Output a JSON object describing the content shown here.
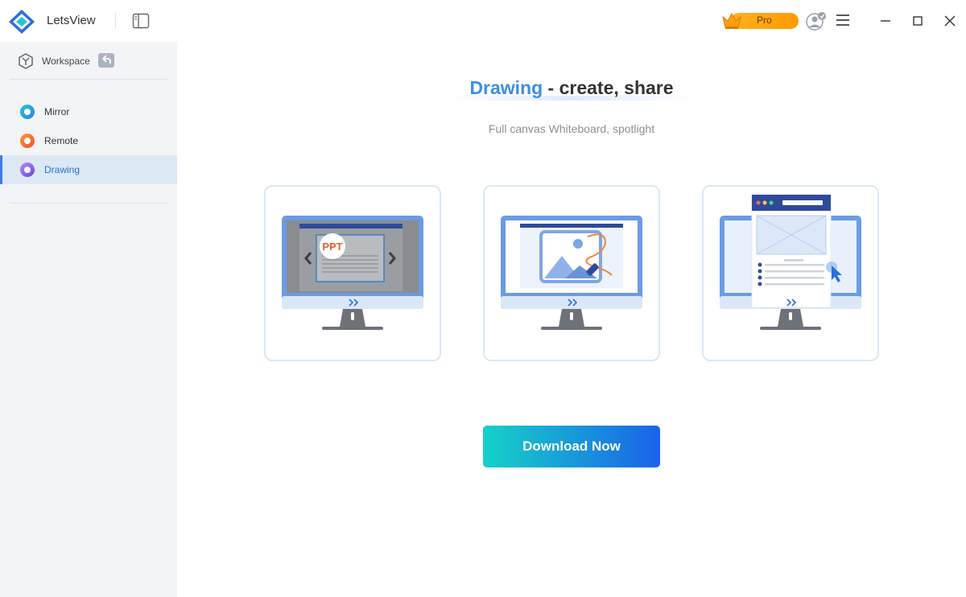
{
  "app": {
    "title": "LetsView"
  },
  "titlebar": {
    "pro_label": "Pro",
    "icons": [
      "letsview-logo-icon",
      "sidebar-toggle-icon",
      "crown-icon",
      "user-icon",
      "menu-icon",
      "minimize-icon",
      "maximize-icon",
      "close-icon"
    ]
  },
  "sidebar": {
    "workspace_label": "Workspace",
    "items": [
      {
        "label": "Mirror",
        "icon": "mirror-icon",
        "active": false
      },
      {
        "label": "Remote",
        "icon": "remote-icon",
        "active": false
      },
      {
        "label": "Drawing",
        "icon": "drawing-icon",
        "active": true
      }
    ]
  },
  "main": {
    "headline_accent": "Drawing",
    "headline_rest": " - create, share",
    "subheadline": "Full canvas Whiteboard, spotlight",
    "cards": [
      {
        "icon": "presentation-slide-illustration",
        "badge": "PPT"
      },
      {
        "icon": "image-drawing-illustration"
      },
      {
        "icon": "spotlight-document-illustration"
      }
    ],
    "download_label": "Download Now"
  },
  "colors": {
    "accent": "#3d8fe0",
    "active_nav_bg": "#dde8f5",
    "pro_gold": "#ffa30f",
    "button_gradient_start": "#15d2c8",
    "button_gradient_end": "#1a62ea"
  }
}
